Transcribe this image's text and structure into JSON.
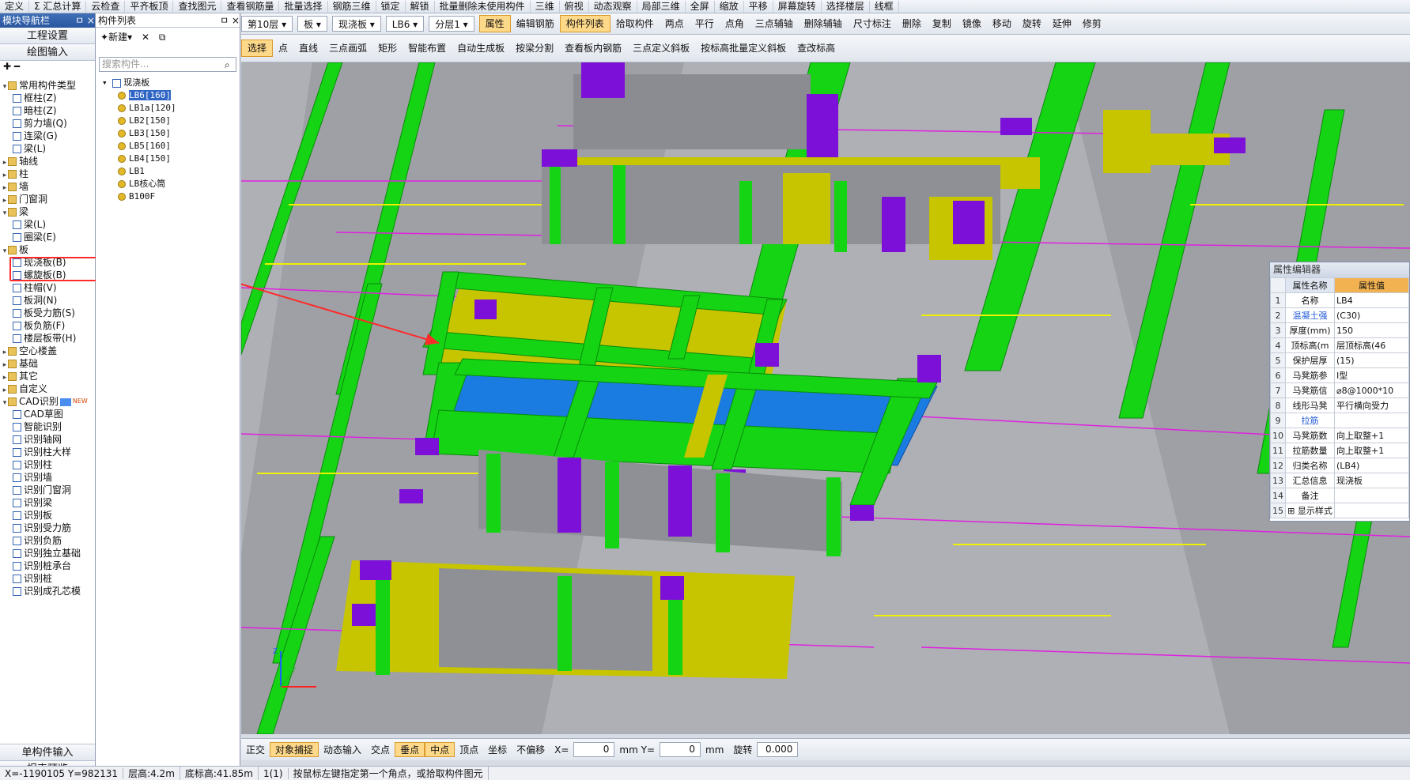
{
  "top_toolbar": [
    "定义",
    "Σ 汇总计算",
    "云检查",
    "平齐板顶",
    "查找图元",
    "查看钢筋量",
    "批量选择",
    "钢筋三维",
    "锁定",
    "解锁",
    "批量删除未使用构件",
    "三维",
    "俯视",
    "动态观察",
    "局部三维",
    "全屏",
    "缩放",
    "平移",
    "屏幕旋转",
    "选择楼层",
    "线框"
  ],
  "nav": {
    "title": "模块导航栏",
    "pin": "ㅁ ×",
    "btn_project": "工程设置",
    "btn_draw": "绘图输入",
    "btn_single": "单构件输入",
    "btn_report": "报表预览",
    "tree": [
      {
        "label": "常用构件类型",
        "level": 0,
        "folder": true,
        "open": true
      },
      {
        "label": "框柱(Z)",
        "level": 1
      },
      {
        "label": "暗柱(Z)",
        "level": 1
      },
      {
        "label": "剪力墙(Q)",
        "level": 1
      },
      {
        "label": "连梁(G)",
        "level": 1
      },
      {
        "label": "梁(L)",
        "level": 1
      },
      {
        "label": "轴线",
        "level": 0,
        "folder": true
      },
      {
        "label": "柱",
        "level": 0,
        "folder": true
      },
      {
        "label": "墙",
        "level": 0,
        "folder": true
      },
      {
        "label": "门窗洞",
        "level": 0,
        "folder": true
      },
      {
        "label": "梁",
        "level": 0,
        "folder": true,
        "open": true
      },
      {
        "label": "梁(L)",
        "level": 1
      },
      {
        "label": "圈梁(E)",
        "level": 1
      },
      {
        "label": "板",
        "level": 0,
        "folder": true,
        "open": true
      },
      {
        "label": "现浇板(B)",
        "level": 1,
        "highlight": true
      },
      {
        "label": "螺旋板(B)",
        "level": 1
      },
      {
        "label": "柱帽(V)",
        "level": 1
      },
      {
        "label": "板洞(N)",
        "level": 1
      },
      {
        "label": "板受力筋(S)",
        "level": 1
      },
      {
        "label": "板负筋(F)",
        "level": 1
      },
      {
        "label": "楼层板带(H)",
        "level": 1
      },
      {
        "label": "空心楼盖",
        "level": 0,
        "folder": true
      },
      {
        "label": "基础",
        "level": 0,
        "folder": true
      },
      {
        "label": "其它",
        "level": 0,
        "folder": true
      },
      {
        "label": "自定义",
        "level": 0,
        "folder": true
      },
      {
        "label": "CAD识别",
        "level": 0,
        "folder": true,
        "open": true,
        "new": "NEW"
      },
      {
        "label": "CAD草图",
        "level": 1
      },
      {
        "label": "智能识别",
        "level": 1
      },
      {
        "label": "识别轴网",
        "level": 1
      },
      {
        "label": "识别柱大样",
        "level": 1
      },
      {
        "label": "识别柱",
        "level": 1
      },
      {
        "label": "识别墙",
        "level": 1
      },
      {
        "label": "识别门窗洞",
        "level": 1
      },
      {
        "label": "识别梁",
        "level": 1
      },
      {
        "label": "识别板",
        "level": 1
      },
      {
        "label": "识别受力筋",
        "level": 1
      },
      {
        "label": "识别负筋",
        "level": 1
      },
      {
        "label": "识别独立基础",
        "level": 1
      },
      {
        "label": "识别桩承台",
        "level": 1
      },
      {
        "label": "识别桩",
        "level": 1
      },
      {
        "label": "识别成孔芯模",
        "level": 1
      }
    ]
  },
  "component_list": {
    "title": "构件列表",
    "new_label": "新建",
    "search_placeholder": "搜索构件...",
    "root": "现浇板",
    "items": [
      "LB6[160]",
      "LB1a[120]",
      "LB2[150]",
      "LB3[150]",
      "LB5[160]",
      "LB4[150]",
      "LB1",
      "LB核心筒",
      "B100F"
    ],
    "selected": "LB6[160]"
  },
  "view_toolbar1": {
    "floor": "第10层",
    "type": "板",
    "subtype": "现浇板",
    "comp": "LB6",
    "layer": "分层1",
    "buttons": [
      "属性",
      "编辑钢筋",
      "构件列表",
      "拾取构件",
      "两点",
      "平行",
      "点角",
      "三点辅轴",
      "删除辅轴",
      "尺寸标注",
      "删除",
      "复制",
      "镜像",
      "移动",
      "旋转",
      "延伸",
      "修剪"
    ]
  },
  "view_toolbar2": [
    "选择",
    "点",
    "直线",
    "三点画弧",
    "矩形",
    "智能布置",
    "自动生成板",
    "按梁分割",
    "查看板内钢筋",
    "三点定义斜板",
    "按标高批量定义斜板",
    "查改标高"
  ],
  "properties": {
    "title": "属性编辑器",
    "col_name": "属性名称",
    "col_value": "属性值",
    "rows": [
      {
        "n": "1",
        "k": "名称",
        "v": "LB4",
        "blue": false
      },
      {
        "n": "2",
        "k": "混凝土强",
        "v": "(C30)",
        "blue": true
      },
      {
        "n": "3",
        "k": "厚度(mm)",
        "v": "150",
        "blue": false
      },
      {
        "n": "4",
        "k": "顶标高(m",
        "v": "层顶标高(46",
        "blue": false
      },
      {
        "n": "5",
        "k": "保护层厚",
        "v": "(15)",
        "blue": false
      },
      {
        "n": "6",
        "k": "马凳筋参",
        "v": "Ⅰ型",
        "blue": false
      },
      {
        "n": "7",
        "k": "马凳筋信",
        "v": "⌀8@1000*10",
        "blue": false
      },
      {
        "n": "8",
        "k": "线形马凳",
        "v": "平行横向受力",
        "blue": false
      },
      {
        "n": "9",
        "k": "拉筋",
        "v": "",
        "blue": true
      },
      {
        "n": "10",
        "k": "马凳筋数",
        "v": "向上取整+1",
        "blue": false
      },
      {
        "n": "11",
        "k": "拉筋数量",
        "v": "向上取整+1",
        "blue": false
      },
      {
        "n": "12",
        "k": "归类名称",
        "v": "(LB4)",
        "blue": false
      },
      {
        "n": "13",
        "k": "汇总信息",
        "v": "现浇板",
        "blue": false
      },
      {
        "n": "14",
        "k": "备注",
        "v": "",
        "blue": false
      },
      {
        "n": "15",
        "k": "⊞ 显示样式",
        "v": "",
        "blue": false
      }
    ]
  },
  "bottom_bar": {
    "items": [
      "正交",
      "对象捕捉",
      "动态输入",
      "交点",
      "垂点",
      "中点",
      "顶点",
      "坐标",
      "不偏移"
    ],
    "x_label": "X=",
    "x_val": "0",
    "y_label": "mm Y=",
    "y_val": "0",
    "mm": "mm",
    "rotate": "旋转",
    "rot_val": "0.000"
  },
  "status": [
    "X=-1190105 Y=982131",
    "层高:4.2m",
    "底标高:41.85m",
    "1(1)",
    "按鼠标左键指定第一个角点，或拾取构件图元"
  ],
  "colors": {
    "beam": "#14d414",
    "slab": "#1a7be0",
    "column": "#7c10d8",
    "wall": "#b8b800",
    "floor": "#a9abb0",
    "highlight": "#ff2a2a"
  }
}
